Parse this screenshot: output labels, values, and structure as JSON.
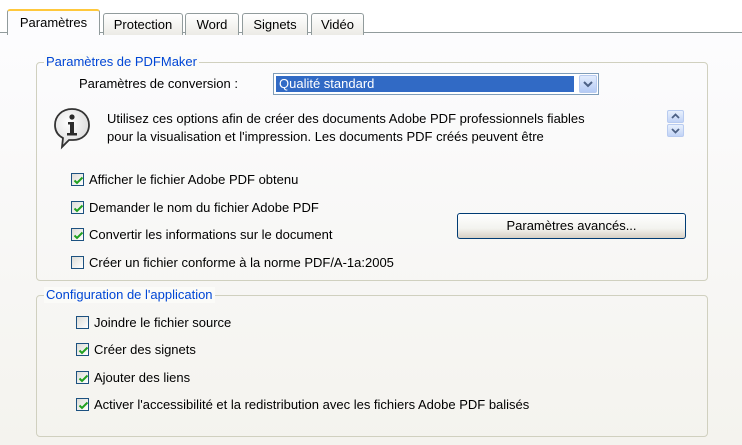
{
  "tabs": [
    {
      "label": "Paramètres"
    },
    {
      "label": "Protection"
    },
    {
      "label": "Word"
    },
    {
      "label": "Signets"
    },
    {
      "label": "Vidéo"
    }
  ],
  "pdfmaker": {
    "legend": "Paramètres de PDFMaker",
    "conversion_label": "Paramètres de conversion :",
    "conversion_value": "Qualité standard",
    "description_line1": "Utilisez ces options afin de créer des documents Adobe PDF professionnels fiables",
    "description_line2": "pour la visualisation et l'impression. Les documents PDF créés peuvent être",
    "options": [
      {
        "label": "Afficher le fichier Adobe PDF obtenu",
        "checked": true
      },
      {
        "label": "Demander le nom du fichier Adobe PDF",
        "checked": true
      },
      {
        "label": "Convertir les informations sur le document",
        "checked": true
      },
      {
        "label": "Créer un fichier conforme à la norme PDF/A-1a:2005",
        "checked": false
      }
    ],
    "advanced_button": "Paramètres avancés..."
  },
  "app_config": {
    "legend": "Configuration de l'application",
    "options": [
      {
        "label": "Joindre le fichier source",
        "checked": false
      },
      {
        "label": "Créer des signets",
        "checked": true
      },
      {
        "label": "Ajouter des liens",
        "checked": true
      },
      {
        "label": "Activer l'accessibilité et la redistribution avec les fichiers Adobe PDF balisés",
        "checked": true
      }
    ]
  },
  "colors": {
    "legend_text": "#0046d5",
    "selection": "#316ac5",
    "check_mark": "#21a121",
    "active_tab_accent": "#ffc83c"
  }
}
